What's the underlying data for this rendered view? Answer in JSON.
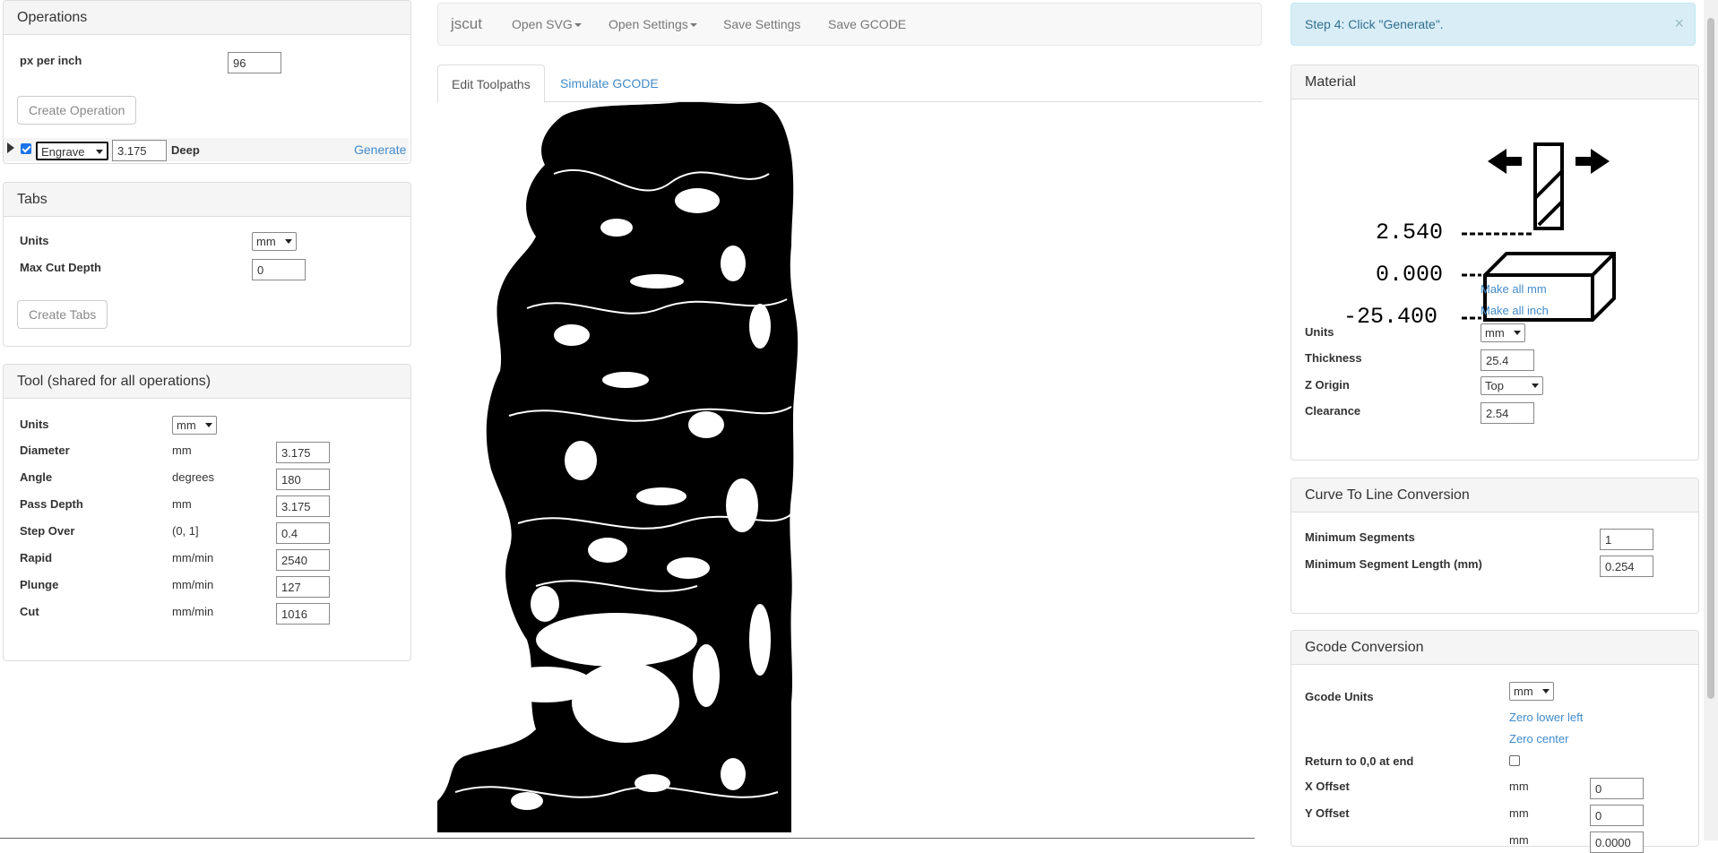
{
  "operations": {
    "heading": "Operations",
    "px_per_inch_label": "px per inch",
    "px_per_inch_value": "96",
    "create_button": "Create Operation",
    "row": {
      "type": "Engrave",
      "depth": "3.175",
      "deep_label": "Deep",
      "generate": "Generate"
    }
  },
  "tabs_panel": {
    "heading": "Tabs",
    "units_label": "Units",
    "units_value": "mm",
    "max_cut_depth_label": "Max Cut Depth",
    "max_cut_depth_value": "0",
    "create_button": "Create Tabs"
  },
  "tool": {
    "heading": "Tool (shared for all operations)",
    "units_label": "Units",
    "units_value": "mm",
    "rows": [
      {
        "label": "Diameter",
        "unit": "mm",
        "value": "3.175"
      },
      {
        "label": "Angle",
        "unit": "degrees",
        "value": "180"
      },
      {
        "label": "Pass Depth",
        "unit": "mm",
        "value": "3.175"
      },
      {
        "label": "Step Over",
        "unit": "(0, 1]",
        "value": "0.4"
      },
      {
        "label": "Rapid",
        "unit": "mm/min",
        "value": "2540"
      },
      {
        "label": "Plunge",
        "unit": "mm/min",
        "value": "127"
      },
      {
        "label": "Cut",
        "unit": "mm/min",
        "value": "1016"
      }
    ]
  },
  "navbar": {
    "brand": "jscut",
    "items": [
      "Open SVG",
      "Open Settings",
      "Save Settings",
      "Save GCODE"
    ]
  },
  "view_tabs": {
    "edit": "Edit Toolpaths",
    "simulate": "Simulate GCODE"
  },
  "alert": {
    "text": "Step 4: Click \"Generate\".",
    "close": "×"
  },
  "material": {
    "heading": "Material",
    "diagram": {
      "clearance": "2.540",
      "origin": "0.000",
      "bottom": "-25.400"
    },
    "make_all_mm": "Make all mm",
    "make_all_inch": "Make all inch",
    "units_label": "Units",
    "units_value": "mm",
    "thickness_label": "Thickness",
    "thickness_value": "25.4",
    "zorigin_label": "Z Origin",
    "zorigin_value": "Top",
    "clearance_label": "Clearance",
    "clearance_value": "2.54"
  },
  "curve": {
    "heading": "Curve To Line Conversion",
    "min_segments_label": "Minimum Segments",
    "min_segments_value": "1",
    "min_length_label": "Minimum Segment Length (mm)",
    "min_length_value": "0.254"
  },
  "gcode": {
    "heading": "Gcode Conversion",
    "units_label": "Gcode Units",
    "units_value": "mm",
    "zero_lower_left": "Zero lower left",
    "zero_center": "Zero center",
    "return_label": "Return to 0,0 at end",
    "x_offset_label": "X Offset",
    "x_offset_unit": "mm",
    "x_offset_value": "0",
    "y_offset_label": "Y Offset",
    "y_offset_unit": "mm",
    "y_offset_value": "0",
    "cut_off_unit": "mm",
    "cut_off_value": "0.0000"
  },
  "canvas": {
    "description_icon": "toolpath-artwork"
  }
}
